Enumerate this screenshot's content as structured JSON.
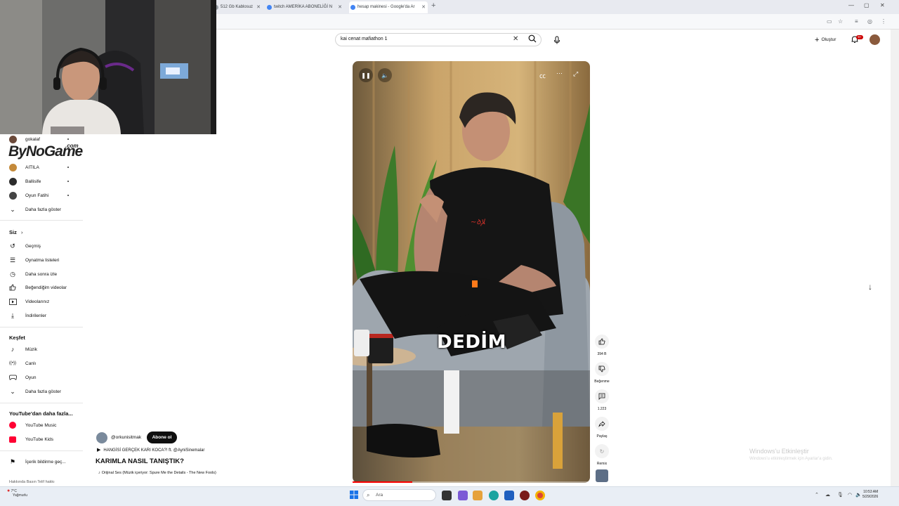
{
  "browser": {
    "tabs": [
      {
        "label": "512 Gb Kablosuz",
        "favicon_color": "#9aa0a6"
      },
      {
        "label": "twitch AMERİKA ABONELİĞİ N",
        "favicon_color": "#4285f4"
      },
      {
        "label": "hesap makinesi - Google'da Ar",
        "favicon_color": "#4285f4"
      }
    ],
    "new_tab_icon": "plus-icon"
  },
  "webcam": {
    "overlay_text": "ByNoGame",
    "overlay_suffix": ".com"
  },
  "sidebar": {
    "subscriptions": [
      {
        "label": "gokalaf",
        "avatar_color": "#6b4a3a",
        "live": true
      },
      {
        "label": "AITILA",
        "avatar_color": "#c48a3a",
        "live": true
      },
      {
        "label": "Ballisife",
        "avatar_color": "#2b2b2b",
        "live": true
      },
      {
        "label": "Oyun Fatihi",
        "avatar_color": "#444444",
        "live": true
      }
    ],
    "show_more_1": "Daha fazla göster",
    "you_heading": "Siz",
    "you_items": [
      {
        "label": "Geçmiş",
        "icon": "history-icon",
        "glyph": "↺"
      },
      {
        "label": "Oynatma listeleri",
        "icon": "playlists-icon",
        "glyph": "☰"
      },
      {
        "label": "Daha sonra izle",
        "icon": "watch-later-icon",
        "glyph": "◷"
      },
      {
        "label": "Beğendiğim videolar",
        "icon": "liked-icon",
        "glyph": "👍"
      },
      {
        "label": "Videolarınız",
        "icon": "your-videos-icon",
        "glyph": "▷"
      },
      {
        "label": "İndirilenler",
        "icon": "downloads-icon",
        "glyph": "⤓"
      }
    ],
    "explore_heading": "Keşfet",
    "explore_items": [
      {
        "label": "Müzik",
        "icon": "music-icon",
        "glyph": "♪"
      },
      {
        "label": "Canlı",
        "icon": "live-icon",
        "glyph": "((•))"
      },
      {
        "label": "Oyun",
        "icon": "gaming-icon",
        "glyph": "🎮"
      }
    ],
    "show_more_2": "Daha fazla göster",
    "more_heading": "YouTube'dan daha fazla...",
    "more_items": [
      {
        "label": "YouTube Music",
        "icon": "youtube-music-icon",
        "color": "#ff0033"
      },
      {
        "label": "YouTube Kids",
        "icon": "youtube-kids-icon",
        "color": "#ff0033"
      }
    ],
    "report": "İçerik bildirme geç...",
    "footer": "Hakkında   Basın   Telif hakkı"
  },
  "header": {
    "search_value": "kai cenat mafiathon 1",
    "create_label": "Oluştur",
    "notification_badge": "9+"
  },
  "video": {
    "caption": "DEDİM",
    "progress_fraction": 0.25
  },
  "actions": {
    "like_count": "394 B",
    "dislike_label": "Beğenme",
    "comment_count": "1.223",
    "share_label": "Paylaş",
    "remix_label": "Remix"
  },
  "meta": {
    "channel": "@orkunisitmak",
    "subscribe_label": "Abone ol",
    "playlist": "HANGİSİ GERÇEK KARI KOCA?! ft. @AyniSinemalar",
    "title": "KARIMLA NASIL TANIŞTIK?",
    "audio": "Orijinal Ses (Müzik içeriyor: Spure Me the Details - The New Fools)"
  },
  "watermark": {
    "line1": "Windows'u Etkinleştir",
    "line2": "Windows'u etkinleştirmek için Ayarlar'a gidin."
  },
  "taskbar": {
    "weather_temp": "7°C",
    "weather_desc": "Yağmurlu",
    "search_placeholder": "Ara",
    "time": "10:53 AM",
    "date": "5/29/2026"
  }
}
